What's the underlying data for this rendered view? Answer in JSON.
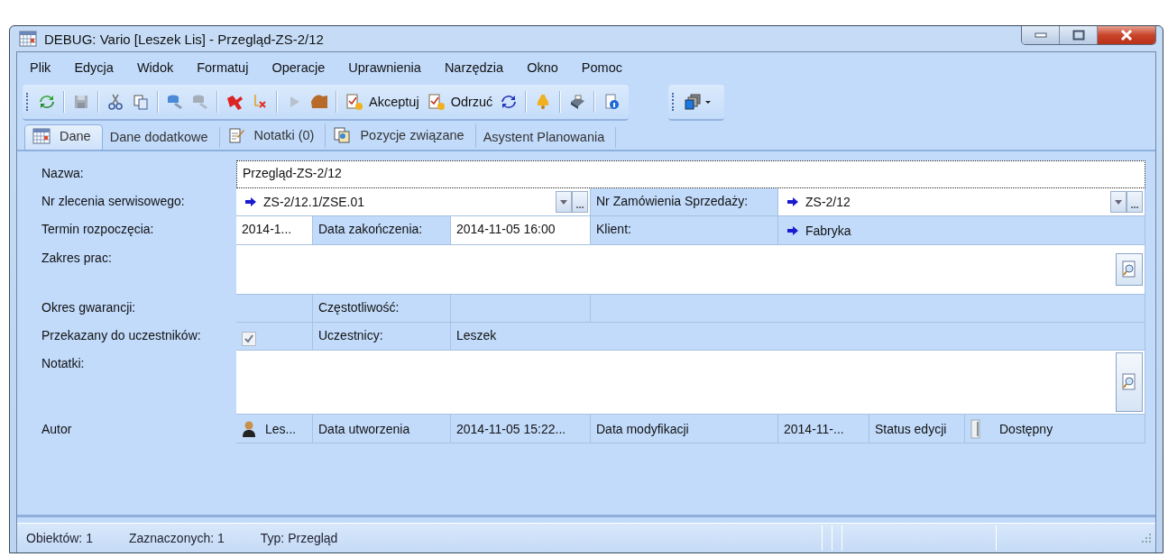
{
  "window": {
    "title": "DEBUG: Vario [Leszek Lis] - Przegląd-ZS-2/12"
  },
  "menu": [
    {
      "label": "Plik"
    },
    {
      "label": "Edycja"
    },
    {
      "label": "Widok"
    },
    {
      "label": "Formatuj"
    },
    {
      "label": "Operacje"
    },
    {
      "label": "Uprawnienia"
    },
    {
      "label": "Narzędzia"
    },
    {
      "label": "Okno"
    },
    {
      "label": "Pomoc"
    }
  ],
  "toolbar": [
    {
      "kind": "icon",
      "disabled": false
    },
    {
      "kind": "separator"
    },
    {
      "kind": "icon",
      "disabled": true
    },
    {
      "kind": "separator"
    },
    {
      "kind": "icon",
      "disabled": false
    },
    {
      "kind": "icon",
      "disabled": false
    },
    {
      "kind": "separator"
    },
    {
      "kind": "icon",
      "disabled": false
    },
    {
      "kind": "icon",
      "disabled": true
    },
    {
      "kind": "separator"
    },
    {
      "kind": "icon",
      "disabled": false
    },
    {
      "kind": "icon",
      "disabled": false
    },
    {
      "kind": "separator"
    },
    {
      "kind": "icon",
      "disabled": true
    },
    {
      "kind": "icon",
      "disabled": false
    },
    {
      "kind": "separator"
    },
    {
      "kind": "button",
      "label": "Akceptuj",
      "disabled": false
    },
    {
      "kind": "button",
      "label": "Odrzuć",
      "disabled": false
    },
    {
      "kind": "icon",
      "disabled": false
    },
    {
      "kind": "separator"
    },
    {
      "kind": "icon",
      "disabled": false
    },
    {
      "kind": "separator"
    },
    {
      "kind": "icon",
      "disabled": false
    },
    {
      "kind": "separator"
    },
    {
      "kind": "icon",
      "disabled": false
    }
  ],
  "tabs": [
    {
      "label": "Dane",
      "selected": true
    },
    {
      "label": "Dane dodatkowe",
      "selected": false
    },
    {
      "label": "Notatki (0)",
      "selected": false
    },
    {
      "label": "Pozycje związane",
      "selected": false
    },
    {
      "label": "Asystent Planowania",
      "selected": false
    }
  ],
  "form": {
    "name": {
      "label": "Nazwa:",
      "value": "Przegląd-ZS-2/12"
    },
    "service_order": {
      "label": "Nr zlecenia serwisowego:",
      "value": "ZS-2/12.1/ZSE.01",
      "browse_button": "..."
    },
    "sales_order": {
      "label": "Nr Zamówienia Sprzedaży:",
      "value": "ZS-2/12",
      "browse_button": "..."
    },
    "start": {
      "label": "Termin rozpoczęcia:",
      "value": "2014-1..."
    },
    "end": {
      "label": "Data zakończenia:",
      "value": "2014-11-05 16:00"
    },
    "client": {
      "label": "Klient:",
      "value": "Fabryka"
    },
    "scope": {
      "label": "Zakres prac:"
    },
    "warranty": {
      "label": "Okres gwarancji:"
    },
    "frequency": {
      "label": "Częstotliwość:"
    },
    "sent": {
      "label": "Przekazany do uczestników:",
      "checked": true
    },
    "participants": {
      "label": "Uczestnicy:",
      "value": "Leszek"
    },
    "notes": {
      "label": "Notatki:"
    },
    "author": {
      "label": "Autor",
      "value": "Les..."
    },
    "created": {
      "label": "Data utworzenia",
      "value": "2014-11-05 15:22..."
    },
    "modified": {
      "label": "Data modyfikacji",
      "value": "2014-11-..."
    },
    "edit_status": {
      "label": "Status edycji",
      "value": "Dostępny"
    }
  },
  "status_bar": [
    "Obiektów: 1",
    "Zaznaczonych: 1",
    "Typ: Przegląd"
  ]
}
